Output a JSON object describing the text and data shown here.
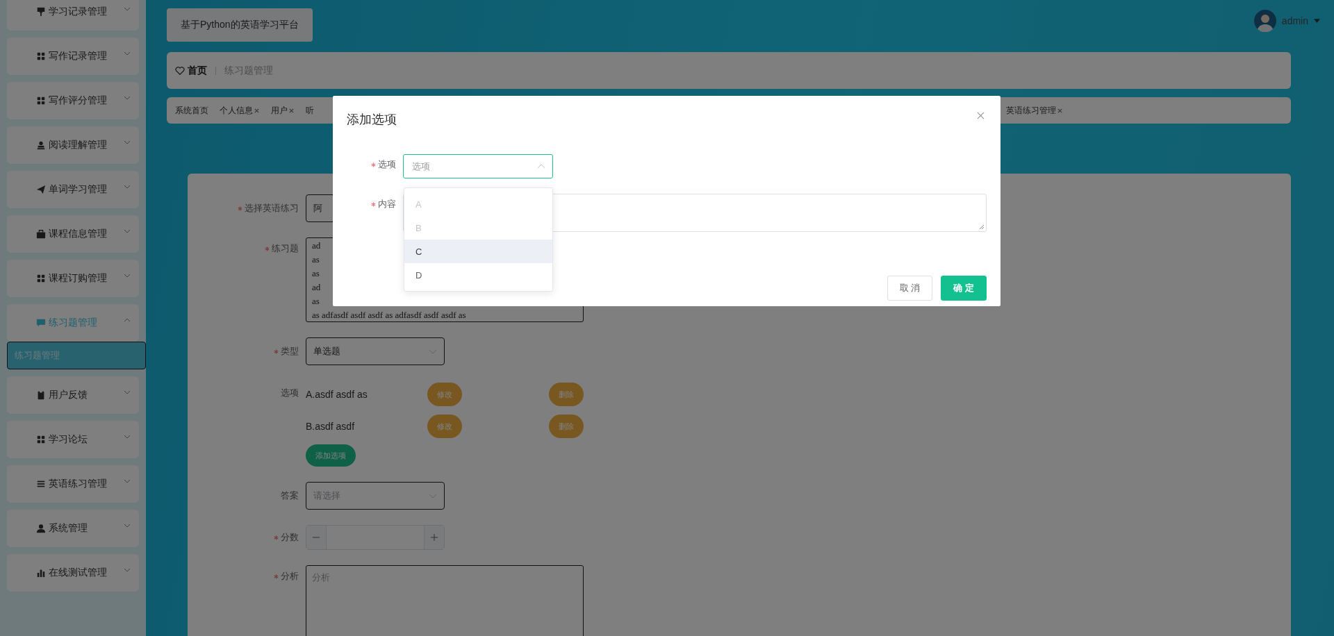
{
  "sidebar": {
    "items": [
      {
        "label": "学习记录管理",
        "expanded": false
      },
      {
        "label": "写作记录管理",
        "expanded": false
      },
      {
        "label": "写作评分管理",
        "expanded": false
      },
      {
        "label": "阅读理解管理",
        "expanded": false
      },
      {
        "label": "单词学习管理",
        "expanded": false
      },
      {
        "label": "课程信息管理",
        "expanded": false
      },
      {
        "label": "课程订购管理",
        "expanded": false
      },
      {
        "label": "练习题管理",
        "expanded": true,
        "children": [
          {
            "label": "练习题管理",
            "selected": true
          }
        ]
      },
      {
        "label": "用户反馈",
        "expanded": false
      },
      {
        "label": "学习论坛",
        "expanded": false
      },
      {
        "label": "英语练习管理",
        "expanded": false
      },
      {
        "label": "系统管理",
        "expanded": false
      },
      {
        "label": "在线测试管理",
        "expanded": false
      }
    ]
  },
  "header": {
    "title": "基于Python的英语学习平台",
    "user": "admin"
  },
  "breadcrumb": [
    "首页",
    "练习题管理"
  ],
  "tabs": [
    {
      "label": "系统首页",
      "closable": false
    },
    {
      "label": "个人信息",
      "closable": true
    },
    {
      "label": "用户",
      "closable": true
    },
    {
      "label": "听",
      "closable": false
    },
    {
      "label": "英语练习管理",
      "closable": true
    }
  ],
  "form": {
    "fields": [
      {
        "kind": "select",
        "label": "选择英语练习",
        "required": true,
        "value": "阿"
      },
      {
        "kind": "textarea",
        "label": "练习题",
        "required": true,
        "lines": [
          "ad",
          "as",
          "as",
          "ad",
          "as",
          "as adfasdf asdf asdf as adfasdf asdf asdf as"
        ]
      },
      {
        "kind": "select",
        "label": "类型",
        "required": true,
        "value": "单选题"
      },
      {
        "kind": "options",
        "label": "选项",
        "required": false,
        "options": [
          {
            "text": "A.asdf asdf as",
            "edit": "修改",
            "delete": "删除"
          },
          {
            "text": "B.asdf asdf",
            "edit": "修改",
            "delete": "删除"
          }
        ],
        "add_button": "添加选项"
      },
      {
        "kind": "select",
        "label": "答案",
        "required": false,
        "placeholder": "请选择"
      },
      {
        "kind": "number",
        "label": "分数",
        "required": true
      },
      {
        "kind": "textarea",
        "label": "分析",
        "required": true,
        "placeholder": "分析"
      }
    ]
  },
  "modal": {
    "title": "添加选项",
    "fields": [
      {
        "kind": "select",
        "label": "选项",
        "required": true,
        "placeholder": "选项",
        "open": true
      },
      {
        "kind": "textarea",
        "label": "内容",
        "required": true
      }
    ],
    "dropdown": [
      {
        "label": "A",
        "disabled": true,
        "hovered": false
      },
      {
        "label": "B",
        "disabled": true,
        "hovered": false
      },
      {
        "label": "C",
        "disabled": false,
        "hovered": true
      },
      {
        "label": "D",
        "disabled": false,
        "hovered": false
      }
    ],
    "buttons": [
      {
        "label": "取 消",
        "kind": "default"
      },
      {
        "label": "确 定",
        "kind": "primary"
      }
    ]
  }
}
